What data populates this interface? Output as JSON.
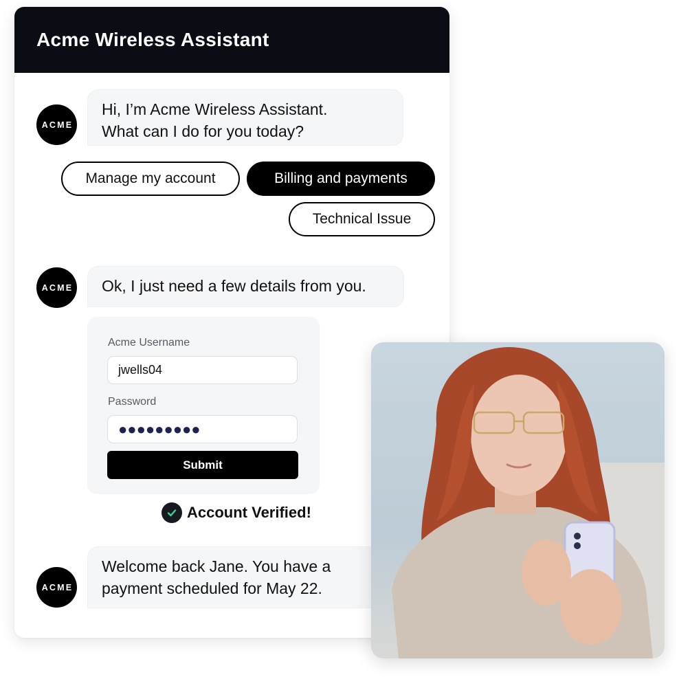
{
  "header": {
    "title": "Acme Wireless Assistant"
  },
  "avatar_label": "ACME",
  "messages": [
    {
      "sender": "bot",
      "lines": [
        "Hi, I’m Acme Wireless Assistant.",
        "What can I do for you today?"
      ]
    },
    {
      "sender": "bot",
      "lines": [
        "Ok, I just need a few details from you."
      ]
    },
    {
      "sender": "bot",
      "lines": [
        "Welcome back Jane. You have a",
        "payment scheduled for May 22."
      ]
    }
  ],
  "quick_replies": [
    {
      "label": "Manage my account",
      "selected": false
    },
    {
      "label": "Billing and payments",
      "selected": true
    },
    {
      "label": "Technical Issue",
      "selected": false
    }
  ],
  "login_form": {
    "username_label": "Acme Username",
    "username_value": "jwells04",
    "password_label": "Password",
    "password_masked": "●●●●●●●●●",
    "submit_label": "Submit"
  },
  "status": {
    "verified_text": "Account Verified!",
    "check_color": "#3ecf9a"
  },
  "photo": {
    "description": "Woman with red hair and glasses smiling while using a smartphone"
  }
}
